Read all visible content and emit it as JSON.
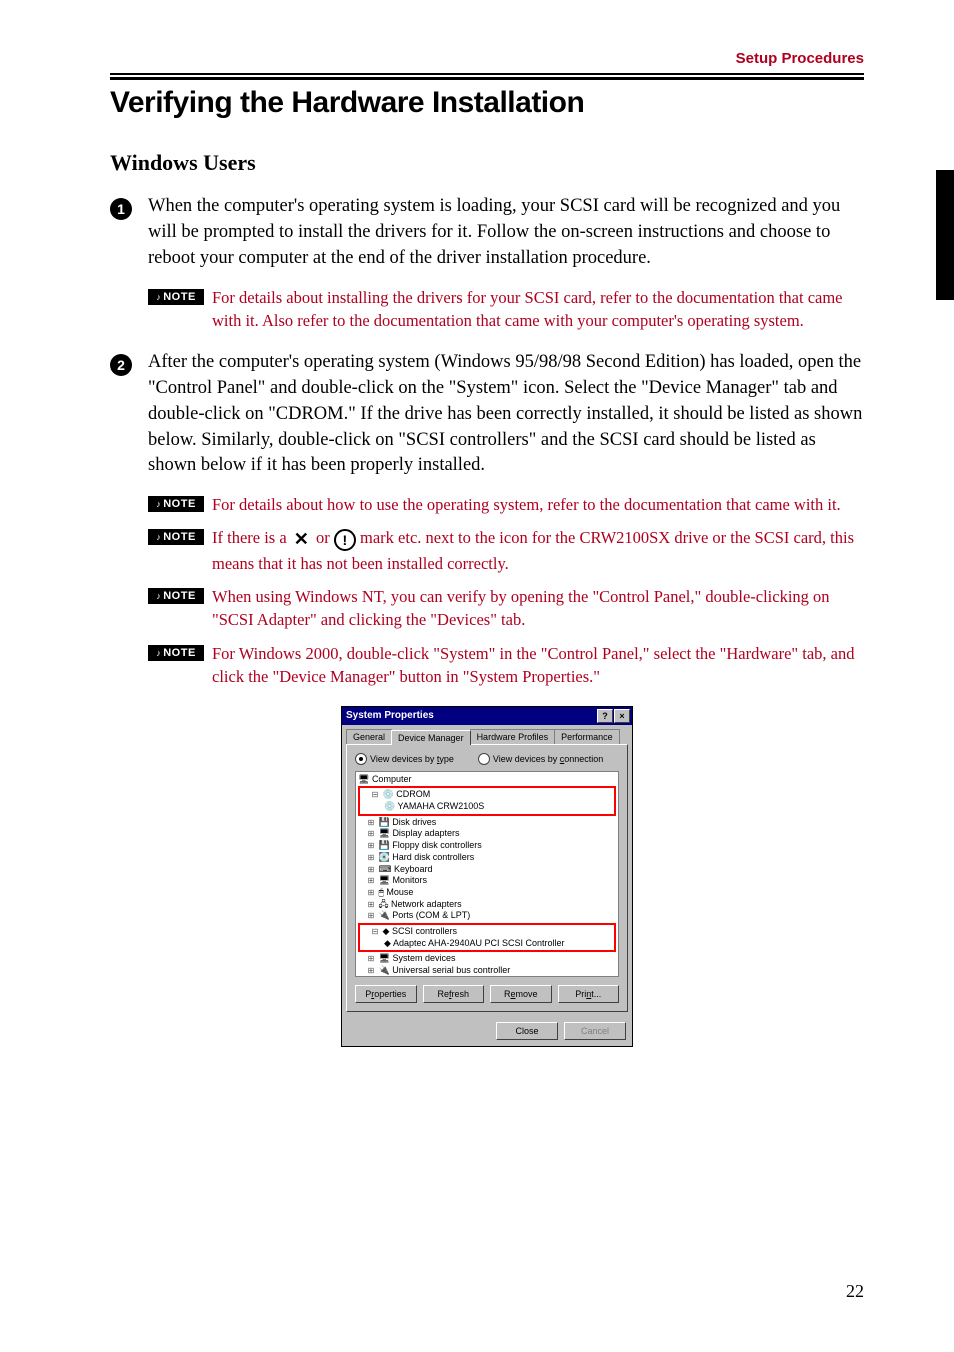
{
  "header": {
    "section": "Setup Procedures"
  },
  "title": "Verifying the Hardware Installation",
  "subhead": "Windows Users",
  "steps": {
    "s1": "When the computer's operating system is loading, your SCSI card will be recognized and you will be prompted to install the drivers for it.  Follow the on-screen instructions and choose to reboot your computer at the end of the driver installation procedure.",
    "s2": "After the computer's operating system (Windows 95/98/98 Second Edition) has loaded, open the \"Control Panel\" and double-click on the \"System\" icon. Select the \"Device Manager\" tab and double-click on \"CDROM.\"  If the drive has been correctly installed, it should be listed as shown below.  Similarly, double-click on \"SCSI controllers\" and the SCSI card should be listed as shown below if it has been properly installed."
  },
  "notes": {
    "badge": "NOTE",
    "n1": "For details about installing the drivers for your SCSI card, refer to the documentation that came with it.  Also refer to the documentation that came with your computer's operating system.",
    "n2": "For details about how to use the operating system, refer to the documentation that came with it.",
    "n3a": "If there is a ",
    "n3b": " or ",
    "n3c": " mark etc. next to the icon for the CRW2100SX drive or the SCSI card, this means that it has not been installed correctly.",
    "n4": "When using Windows NT, you can verify by opening the \"Control Panel,\" double-clicking on \"SCSI Adapter\" and clicking the \"Devices\" tab.",
    "n5": "For Windows 2000, double-click \"System\" in the \"Control Panel,\" select the \"Hardware\" tab, and click the \"Device Manager\" button in \"System Properties.\""
  },
  "dialog": {
    "title": "System Properties",
    "tabs": [
      "General",
      "Device Manager",
      "Hardware Profiles",
      "Performance"
    ],
    "radio1": "View devices by type",
    "radio2": "View devices by connection",
    "tree": {
      "root": "Computer",
      "cdrom": "CDROM",
      "cdrom_child": "YAMAHA CRW2100S",
      "items": [
        "Disk drives",
        "Display adapters",
        "Floppy disk controllers",
        "Hard disk controllers",
        "Keyboard",
        "Monitors",
        "Mouse",
        "Network adapters",
        "Ports (COM & LPT)"
      ],
      "scsi": "SCSI controllers",
      "scsi_child": "Adaptec AHA-2940AU PCI SCSI Controller",
      "tail": [
        "System devices",
        "Universal serial bus controller"
      ]
    },
    "buttons": {
      "properties": "Properties",
      "refresh": "Refresh",
      "remove": "Remove",
      "print": "Print...",
      "close": "Close",
      "cancel": "Cancel"
    }
  },
  "page_number": "22"
}
